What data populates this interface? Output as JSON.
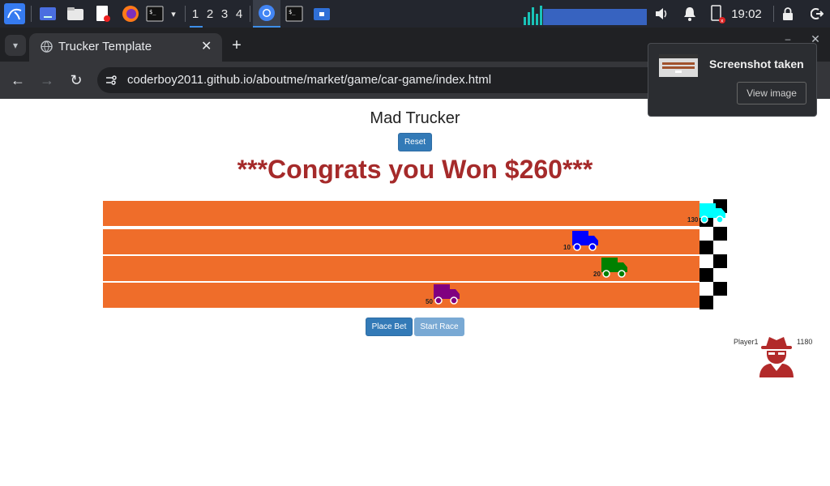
{
  "taskbar": {
    "workspaces": [
      "1",
      "2",
      "3",
      "4"
    ],
    "clock": "19:02"
  },
  "browser": {
    "tab_title": "Trucker Template",
    "url": "coderboy2011.github.io/aboutme/market/game/car-game/index.html"
  },
  "game": {
    "title": "Mad Trucker",
    "reset_label": "Reset",
    "congrats": "***Congrats you Won $260***",
    "place_bet_label": "Place Bet",
    "start_race_label": "Start Race",
    "lanes": [
      {
        "bet": "130",
        "color": "#00ffff"
      },
      {
        "bet": "10",
        "color": "#0000ff"
      },
      {
        "bet": "20",
        "color": "#008000"
      },
      {
        "bet": "50",
        "color": "#800080"
      }
    ],
    "lane_color": "#ef6d2a",
    "player": {
      "name": "Player1",
      "money": "1180"
    }
  },
  "notification": {
    "title": "Screenshot taken",
    "action": "View image"
  }
}
